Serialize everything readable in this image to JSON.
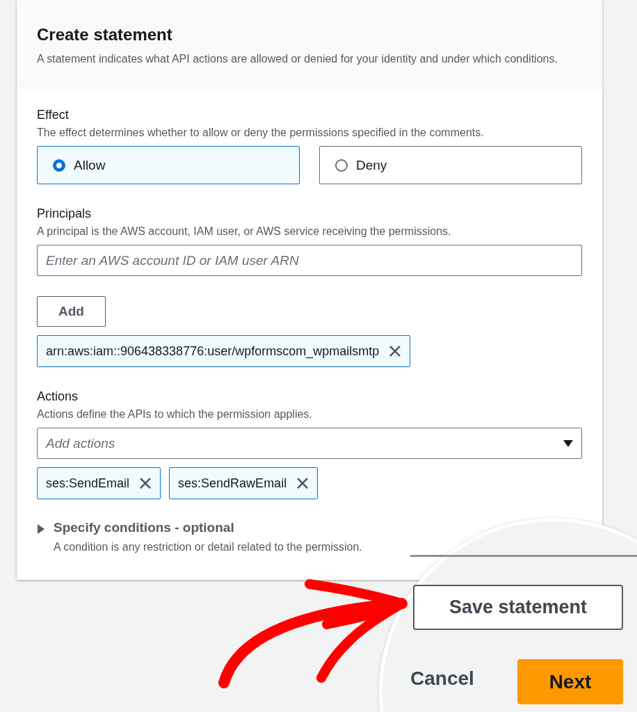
{
  "panel": {
    "title": "Create statement",
    "description": "A statement indicates what API actions are allowed or denied for your identity and under which conditions."
  },
  "effect": {
    "label": "Effect",
    "description": "The effect determines whether to allow or deny the permissions specified in the comments.",
    "options": [
      {
        "label": "Allow",
        "selected": true
      },
      {
        "label": "Deny",
        "selected": false
      }
    ]
  },
  "principals": {
    "label": "Principals",
    "description": "A principal is the AWS account, IAM user, or AWS service receiving the permissions.",
    "input": {
      "placeholder": "Enter an AWS account ID or IAM user ARN"
    },
    "add_button": "Add",
    "tokens": [
      "arn:aws:iam::906438338776:user/wpformscom_wpmailsmtp"
    ]
  },
  "actions": {
    "label": "Actions",
    "description": "Actions define the APIs to which the permission applies.",
    "select": {
      "placeholder": "Add actions"
    },
    "tokens": [
      "ses:SendEmail",
      "ses:SendRawEmail"
    ]
  },
  "conditions": {
    "title": "Specify conditions - optional",
    "description": "A condition is any restriction or detail related to the permission.",
    "expanded": false
  },
  "magnified_footer": {
    "save_button": "Save statement",
    "cancel_button": "Cancel",
    "next_button": "Next"
  }
}
